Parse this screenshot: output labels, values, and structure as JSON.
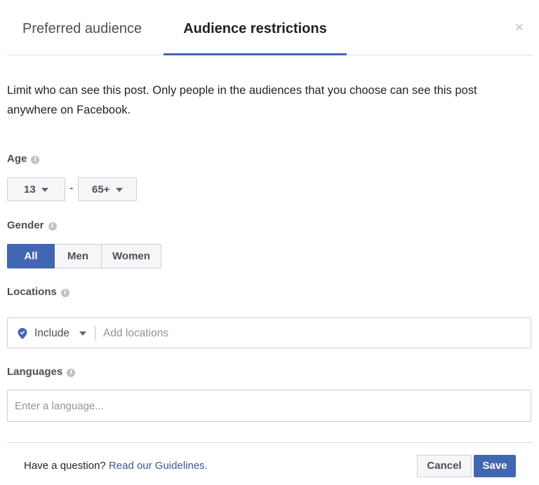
{
  "tabs": [
    {
      "label": "Preferred audience",
      "active": false
    },
    {
      "label": "Audience restrictions",
      "active": true
    }
  ],
  "close_icon": "×",
  "description": "Limit who can see this post. Only people in the audiences that you choose can see this post anywhere on Facebook.",
  "age": {
    "label": "Age",
    "min": "13",
    "separator": "-",
    "max": "65+"
  },
  "gender": {
    "label": "Gender",
    "options": [
      "All",
      "Men",
      "Women"
    ],
    "selected": "All"
  },
  "locations": {
    "label": "Locations",
    "mode": "Include",
    "placeholder": "Add locations"
  },
  "languages": {
    "label": "Languages",
    "placeholder": "Enter a language..."
  },
  "footer": {
    "question": "Have a question?",
    "link": "Read our Guidelines.",
    "cancel": "Cancel",
    "save": "Save"
  },
  "colors": {
    "accent": "#4267b2",
    "link": "#365899"
  }
}
